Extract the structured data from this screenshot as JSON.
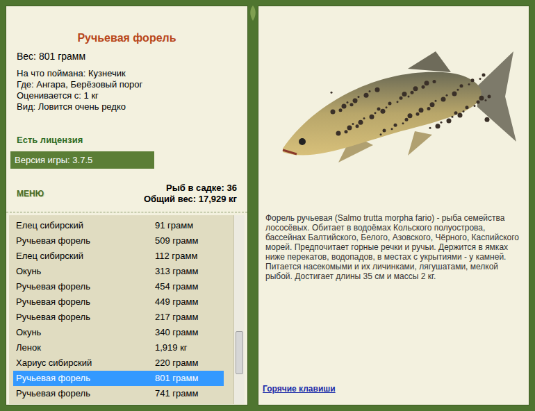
{
  "fish_card": {
    "title": "Ручьевая форель",
    "weight": "Вес: 801 грамм",
    "details": [
      "На что поймана: Кузнечик",
      "Где: Ангара, Берёзовый порог",
      "Оценивается с: 1 кг",
      "Вид: Ловится очень редко"
    ],
    "license": "Есть лицензия",
    "version": "Версия игры: 3.7.5"
  },
  "menu_button": "МЕНЮ",
  "cage": {
    "count": "Рыб в садке: 36",
    "total": "Общий вес: 17,929 кг"
  },
  "catch_list": {
    "scroll_level": 0.88,
    "rows": [
      {
        "name": "Елец сибирский",
        "weight": "91 грамм",
        "selected": false
      },
      {
        "name": "Ручьевая форель",
        "weight": "509 грамм",
        "selected": false
      },
      {
        "name": "Елец сибирский",
        "weight": "112 грамм",
        "selected": false
      },
      {
        "name": "Окунь",
        "weight": "313 грамм",
        "selected": false
      },
      {
        "name": "Ручьевая форель",
        "weight": "454 грамм",
        "selected": false
      },
      {
        "name": "Ручьевая форель",
        "weight": "449 грамм",
        "selected": false
      },
      {
        "name": "Ручьевая форель",
        "weight": "217 грамм",
        "selected": false
      },
      {
        "name": "Окунь",
        "weight": "340 грамм",
        "selected": false
      },
      {
        "name": "Ленок",
        "weight": "1,919 кг",
        "selected": false
      },
      {
        "name": "Хариус сибирский",
        "weight": "220 грамм",
        "selected": false
      },
      {
        "name": "Ручьевая форель",
        "weight": "801 грамм",
        "selected": true
      },
      {
        "name": "Ручьевая форель",
        "weight": "741 грамм",
        "selected": false
      }
    ]
  },
  "description": "Форель ручьевая (Salmo trutta morpha fario) - рыба семейства лососёвых. Обитает в водоёмах Кольского полуострова, бассейнах Балтийского, Белого, Азовского, Чёрного, Каспийского морей. Предпочитает горные речки и ручьи. Держится в ямках ниже перекатов, водопадов, в местах с укрытиями - у камней. Питается насекомыми и их личинками, лягушатами, мелкой рыбой. Достигает длины 35 см и массы 2 кг.",
  "hotkeys_link": "Горячие клавиши"
}
